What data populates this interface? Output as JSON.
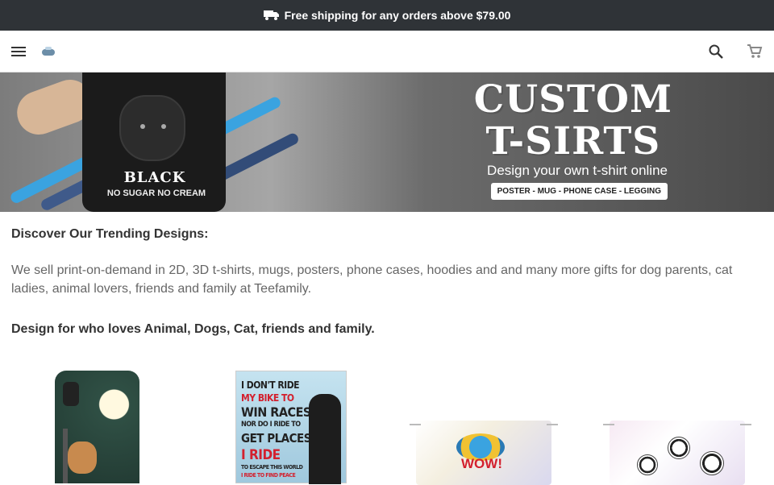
{
  "announcement": {
    "icon": "truck-icon",
    "text": "Free shipping for any orders above $79.00"
  },
  "header": {
    "menu_icon": "menu-icon",
    "logo_icon": "logo-icon",
    "search_icon": "search-icon",
    "cart_icon": "cart-icon"
  },
  "hero": {
    "title_line1": "CUSTOM",
    "title_line2": "T-SIRTS",
    "subtitle": "Design your own t-shirt online",
    "tags": "POSTER - MUG - PHONE CASE - LEGGING",
    "shirt_text": "BLACK",
    "shirt_subtext": "NO SUGAR  NO CREAM"
  },
  "main": {
    "heading": "Discover Our Trending Designs:",
    "description": "We sell print-on-demand in 2D, 3D t-shirts, mugs, posters, phone cases, hoodies and and many more gifts for dog parents, cat ladies, animal lovers, friends and family at Teefamily.",
    "subheading": "Design for who loves Animal, Dogs, Cat, friends and family."
  },
  "products": {
    "poster_lines": [
      "I DON'T RIDE",
      "MY BIKE TO",
      "WIN RACES",
      "NOR DO I RIDE TO",
      "GET PLACES",
      "I RIDE",
      "TO ESCAPE THIS WORLD",
      "I RIDE TO FIND PEACE"
    ],
    "mask1_text": "WOW!",
    "colors": {
      "topbar": "#2f3337",
      "accent_red": "#d3202e"
    }
  }
}
